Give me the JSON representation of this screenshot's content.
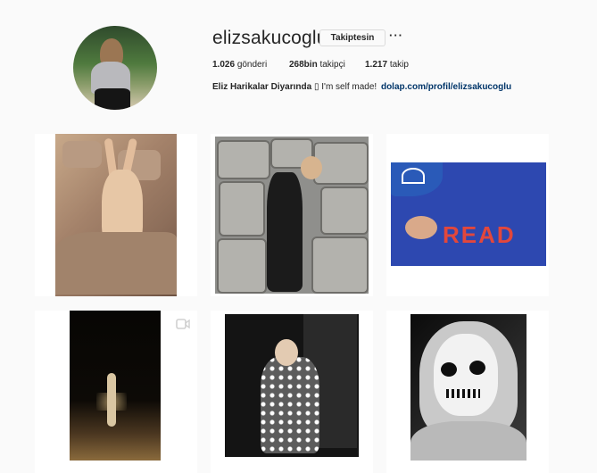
{
  "profile": {
    "username": "elizsakucoglu",
    "follow_button": "Takiptesin",
    "more_label": "···",
    "stats": {
      "posts_value": "1.026",
      "posts_label": "gönderi",
      "followers_value": "268bin",
      "followers_label": "takipçi",
      "following_value": "1.217",
      "following_label": "takip"
    },
    "bio": {
      "name": "Eliz Harikalar Diyarında",
      "emoji": "▯",
      "text": "I'm self made!",
      "link": "dolap.com/profil/elizsakucoglu"
    }
  },
  "posts": [
    {
      "id": "post-1",
      "type": "photo"
    },
    {
      "id": "post-2",
      "type": "photo"
    },
    {
      "id": "post-3",
      "type": "photo",
      "caption_text": "READ"
    },
    {
      "id": "post-4",
      "type": "video"
    },
    {
      "id": "post-5",
      "type": "photo"
    },
    {
      "id": "post-6",
      "type": "photo"
    }
  ],
  "colors": {
    "background": "#fafafa",
    "text": "#262626",
    "link": "#003569",
    "border": "#dbdbdb"
  }
}
